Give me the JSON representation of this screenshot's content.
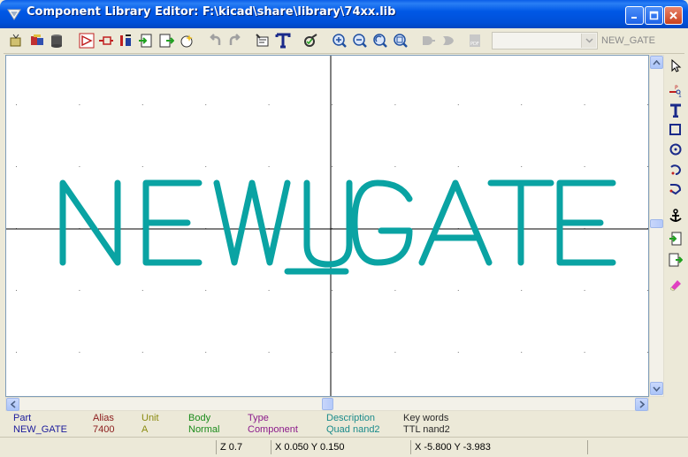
{
  "window": {
    "title": "Component Library Editor: F:\\kicad\\share\\library\\74xx.lib"
  },
  "toolbar": {
    "part_select_value": "",
    "part_name": "NEW_GATE",
    "tools": [
      "select-part",
      "load-part",
      "save-part",
      "new-part",
      "delete-part",
      "edit-pin",
      "export",
      "import",
      "create-new",
      "undo",
      "redo",
      "component-properties",
      "text",
      "check",
      "zoom-in",
      "zoom-out",
      "zoom-redraw",
      "zoom-fit",
      "de-morgan-normal",
      "de-morgan-convert",
      "pdf-datasheet"
    ]
  },
  "canvas": {
    "component_text": "NEWUGATE",
    "text_color": "#0aa3a3",
    "background": "#ffffff"
  },
  "info": {
    "part_label": "Part",
    "part_value": "NEW_GATE",
    "alias_label": "Alias",
    "alias_value": "7400",
    "unit_label": "Unit",
    "unit_value": "A",
    "body_label": "Body",
    "body_value": "Normal",
    "type_label": "Type",
    "type_value": "Component",
    "description_label": "Description",
    "description_value": "Quad nand2",
    "keywords_label": "Key words",
    "keywords_value": "TTL nand2"
  },
  "status": {
    "zoom": "Z 0.7",
    "relative_coords": "X 0.050  Y 0.150",
    "absolute_coords": "X -5.800  Y -3.983"
  }
}
